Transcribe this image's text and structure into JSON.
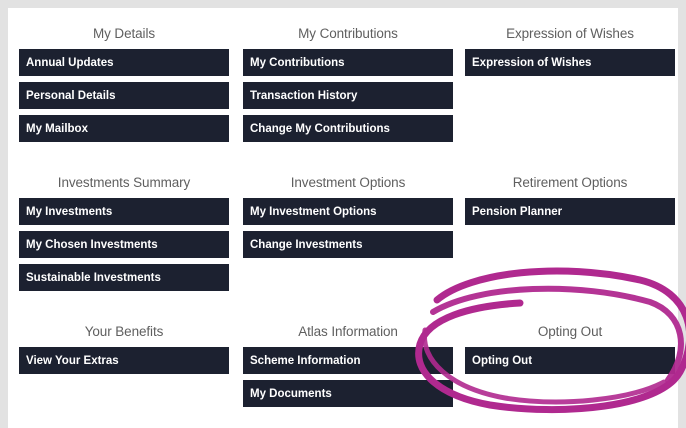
{
  "sections": [
    {
      "title": "My Details",
      "items": [
        "Annual Updates",
        "Personal Details",
        "My Mailbox"
      ]
    },
    {
      "title": "My Contributions",
      "items": [
        "My Contributions",
        "Transaction History",
        "Change My Contributions"
      ]
    },
    {
      "title": "Expression of Wishes",
      "items": [
        "Expression of Wishes"
      ]
    },
    {
      "title": "Investments Summary",
      "items": [
        "My Investments",
        "My Chosen Investments",
        "Sustainable Investments"
      ]
    },
    {
      "title": "Investment Options",
      "items": [
        "My Investment Options",
        "Change Investments"
      ]
    },
    {
      "title": "Retirement Options",
      "items": [
        "Pension Planner"
      ]
    },
    {
      "title": "Your Benefits",
      "items": [
        "View Your Extras"
      ]
    },
    {
      "title": "Atlas Information",
      "items": [
        "Scheme Information",
        "My Documents"
      ]
    },
    {
      "title": "Opting Out",
      "items": [
        "Opting Out"
      ]
    }
  ],
  "colors": {
    "button_bg": "#1c2130",
    "button_text": "#ffffff",
    "title_text": "#5f5f5f",
    "annotation": "#b0298f"
  }
}
